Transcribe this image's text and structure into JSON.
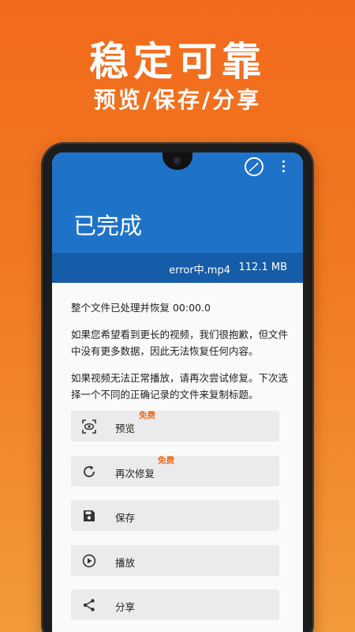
{
  "promo": {
    "headline": "稳定可靠",
    "subheadline": "预览/保存/分享"
  },
  "appbar": {
    "title": "已完成",
    "actions": [
      "feather-icon",
      "more-vert-icon"
    ]
  },
  "file_info": {
    "name": "error中.mp4",
    "size": "112.1 MB"
  },
  "message": {
    "line1": "整个文件已处理并恢复 00:00.0",
    "line2": "如果您希望看到更长的视频，我们很抱歉，但文件中没有更多数据，因此无法恢复任何内容。",
    "line3": "如果视频无法正常播放，请再次尝试修复。下次选择一个不同的正确记录的文件来复制标题。"
  },
  "actions": [
    {
      "label": "预览",
      "badge": "免费",
      "icon": "preview-icon"
    },
    {
      "label": "再次修复",
      "badge": "免费",
      "icon": "refresh-icon"
    },
    {
      "label": "保存",
      "badge": "",
      "icon": "save-icon"
    },
    {
      "label": "播放",
      "badge": "",
      "icon": "play-icon"
    },
    {
      "label": "分享",
      "badge": "",
      "icon": "share-icon"
    }
  ],
  "colors": {
    "background": "#f36a1c",
    "appbar": "#1e73c8",
    "infobar": "#155da8",
    "badge": "#f06a1a",
    "button": "#ebebeb"
  }
}
